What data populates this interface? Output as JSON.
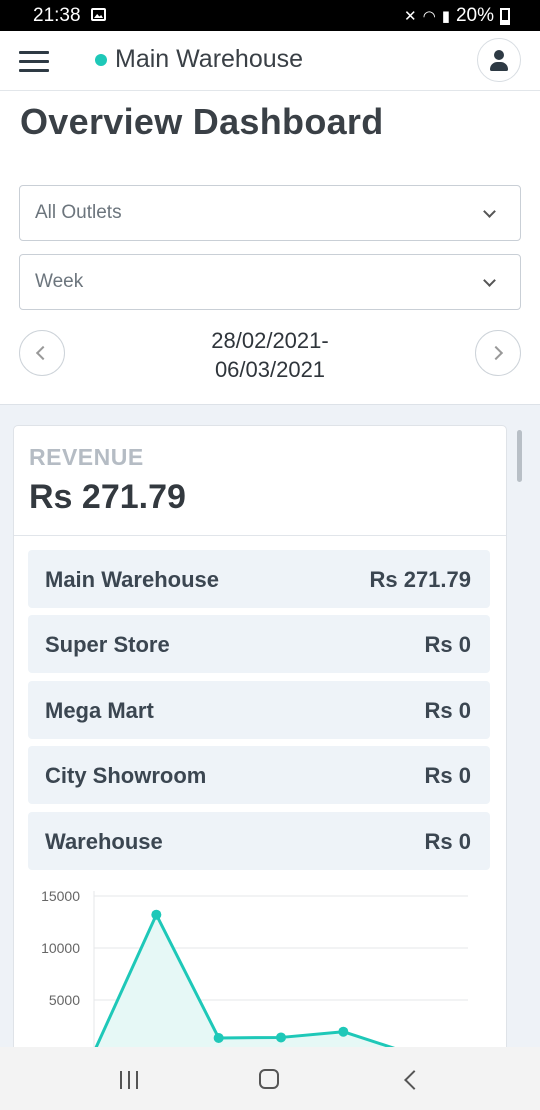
{
  "status_bar": {
    "time": "21:38",
    "battery": "20%"
  },
  "topbar": {
    "location": "Main Warehouse"
  },
  "page": {
    "title": "Overview Dashboard"
  },
  "filters": {
    "outlet": "All Outlets",
    "period": "Week",
    "date_range": "28/02/2021-\n06/03/2021"
  },
  "revenue": {
    "caption": "REVENUE",
    "total": "Rs 271.79",
    "outlets": [
      {
        "name": "Main Warehouse",
        "amount": "Rs 271.79"
      },
      {
        "name": "Super Store",
        "amount": "Rs 0"
      },
      {
        "name": "Mega Mart",
        "amount": "Rs 0"
      },
      {
        "name": "City Showroom",
        "amount": "Rs 0"
      },
      {
        "name": "Warehouse",
        "amount": "Rs 0"
      }
    ]
  },
  "chart_data": {
    "type": "area",
    "title": "",
    "xlabel": "",
    "ylabel": "",
    "y_ticks": [
      "15000",
      "10000",
      "5000"
    ],
    "ylim": [
      0,
      15000
    ],
    "series": [
      {
        "values": [
          0,
          13200,
          1350,
          1400,
          1950,
          0,
          0
        ]
      }
    ],
    "grid": true,
    "line_color": "#1ec8b8",
    "fill_color": "#e6f8f6"
  }
}
